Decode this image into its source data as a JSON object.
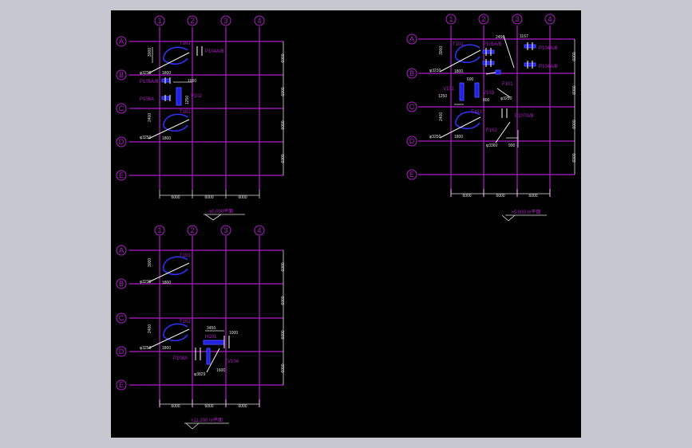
{
  "columns": [
    "1",
    "2",
    "3",
    "4"
  ],
  "rows": [
    "A",
    "B",
    "C",
    "D",
    "E"
  ],
  "span_label": "6000",
  "tags": {
    "T101": "T101",
    "T102": "T102",
    "P104AB_right": "P104A/B",
    "P104AB_left": "P104A/B",
    "P105AB": "P105A/B",
    "P106A": "P106A",
    "P107AB": "P107A/B",
    "P108A": "P108A",
    "P109A": "P109A",
    "V101": "V101",
    "V102": "V102",
    "V103": "V103",
    "V104": "V104",
    "F101": "F101",
    "F102": "F102",
    "H101": "H101",
    "W101": "W101"
  },
  "dims": {
    "d3230": "φ3230",
    "d3250": "φ3250",
    "d1800": "1800",
    "d3000": "3000",
    "d2400": "2400",
    "d2500": "2500",
    "d1250": "1250",
    "d800": "800",
    "d600": "600",
    "d1000": "1000",
    "d900": "900",
    "d1167": "1167",
    "d2450": "2450",
    "d3450": "3450",
    "d3829": "φ3829",
    "d3360": "φ3360",
    "d1600": "1600",
    "d9600": "9600"
  },
  "plans": [
    {
      "id": "plan-1",
      "title": "±0.000平面"
    },
    {
      "id": "plan-2",
      "title": "+5.000 m平面"
    },
    {
      "id": "plan-3",
      "title": "+11.200 m平面"
    }
  ],
  "colors": {
    "canvas": "#000000",
    "frame": "#c7c7cf",
    "axis": "#b01ec8",
    "equipment": "#2020e0",
    "dimension": "#e0e0e0"
  }
}
